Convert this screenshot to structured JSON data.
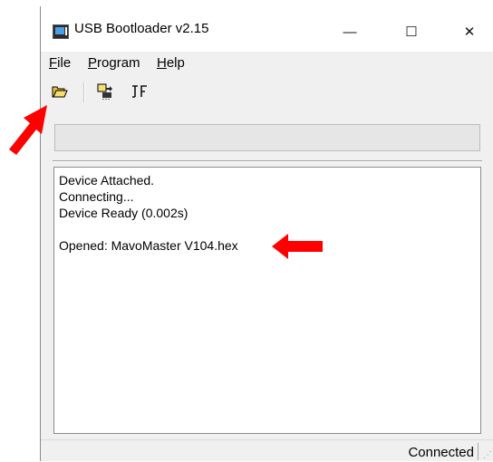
{
  "window": {
    "title": "USB Bootloader v2.15",
    "minimize_glyph": "—",
    "maximize_glyph": "☐",
    "close_glyph": "✕"
  },
  "menu": {
    "file": {
      "accel": "F",
      "rest": "ile"
    },
    "program": {
      "accel": "P",
      "rest": "rogram"
    },
    "help": {
      "accel": "H",
      "rest": "elp"
    }
  },
  "toolbar": {
    "icons": [
      "open-folder-icon",
      "program-device-icon",
      "reset-device-icon"
    ]
  },
  "progress": {
    "value": 0
  },
  "log": {
    "lines": [
      "Device Attached.",
      "Connecting...",
      "Device Ready (0.002s)",
      "",
      "Opened: MavoMaster V104.hex"
    ]
  },
  "status": {
    "text": "Connected"
  },
  "annotations": {
    "arrow_color": "#ff0000"
  }
}
